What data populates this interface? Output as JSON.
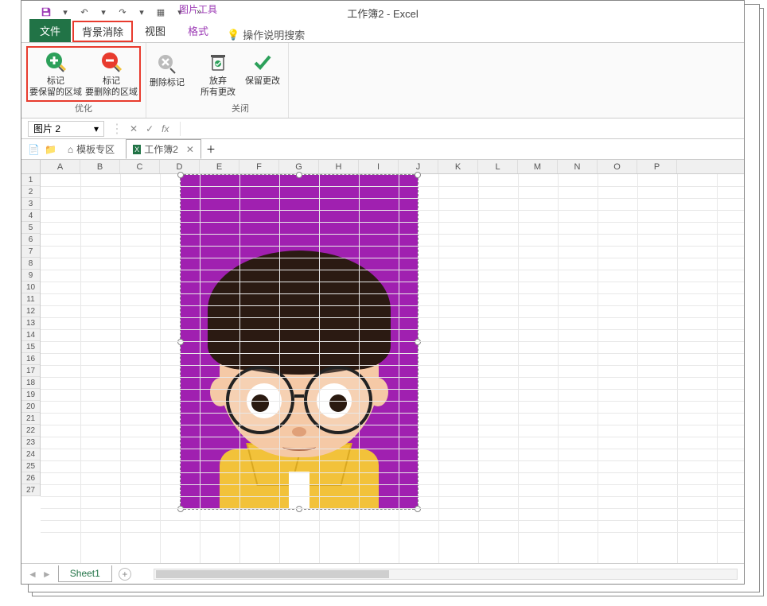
{
  "title": "工作簿2  -  Excel",
  "context_tab_group": "图片工具",
  "tabs": {
    "file": "文件",
    "bgremove": "背景消除",
    "view": "视图",
    "format": "格式",
    "help": "操作说明搜索"
  },
  "ribbon": {
    "mark_keep": {
      "line1": "标记",
      "line2": "要保留的区域"
    },
    "mark_delete": {
      "line1": "标记",
      "line2": "要删除的区域"
    },
    "delete_mark": "删除标记",
    "discard": {
      "line1": "放弃",
      "line2": "所有更改"
    },
    "keep": "保留更改",
    "group_optimize": "优化",
    "group_close": "关闭"
  },
  "namebox": "图片 2",
  "fx": "fx",
  "doc_tabs": {
    "template": "模板专区",
    "wb": "工作簿2"
  },
  "columns": [
    "A",
    "B",
    "C",
    "D",
    "E",
    "F",
    "G",
    "H",
    "I",
    "J",
    "K",
    "L",
    "M",
    "N",
    "O",
    "P"
  ],
  "row_count": 27,
  "sheet": "Sheet1"
}
